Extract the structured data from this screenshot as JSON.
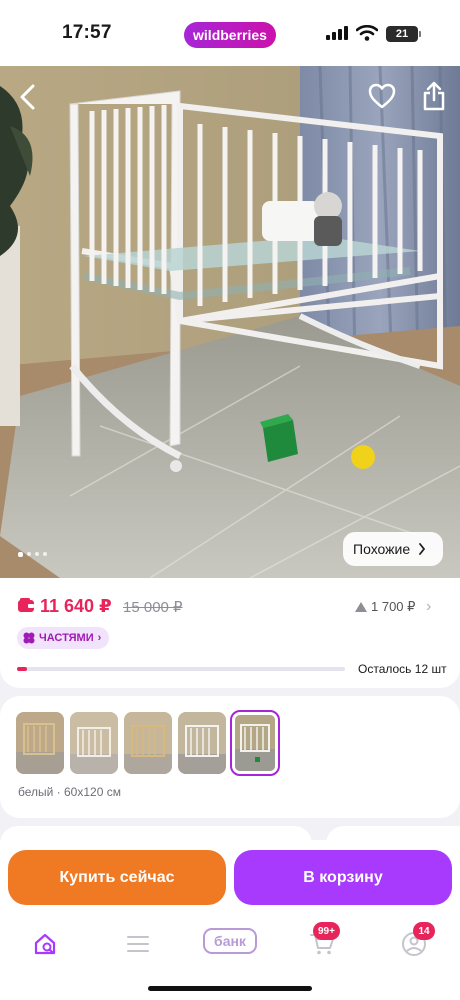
{
  "status_bar": {
    "time": "17:57",
    "brand": "wildberries",
    "battery": "21"
  },
  "hero": {
    "similar_label": "Похожие",
    "dots_count": 4,
    "active_dot": 0
  },
  "price": {
    "current": "11 640 ₽",
    "old": "15 000 ₽",
    "reviews_price": "1 700 ₽",
    "installments": "ЧАСТЯМИ",
    "stock_text": "Осталось 12 шт",
    "stock_fraction": 0.03
  },
  "variants": {
    "color_label": "белый · 60х120 см",
    "thumbs": [
      "variant-1",
      "variant-2",
      "variant-3",
      "variant-4",
      "variant-5"
    ],
    "selected_index": 4
  },
  "actions": {
    "buy_now": "Купить сейчас",
    "add_to_cart": "В корзину"
  },
  "tabbar": {
    "items": [
      "home-search-icon",
      "menu-icon",
      "bank",
      "cart-icon",
      "profile-icon"
    ],
    "bank_label": "банк",
    "cart_badge": "99+",
    "profile_badge": "14"
  },
  "colors": {
    "accent_purple": "#a73afd",
    "buy_orange": "#f07a24",
    "price_red": "#e8255b"
  }
}
